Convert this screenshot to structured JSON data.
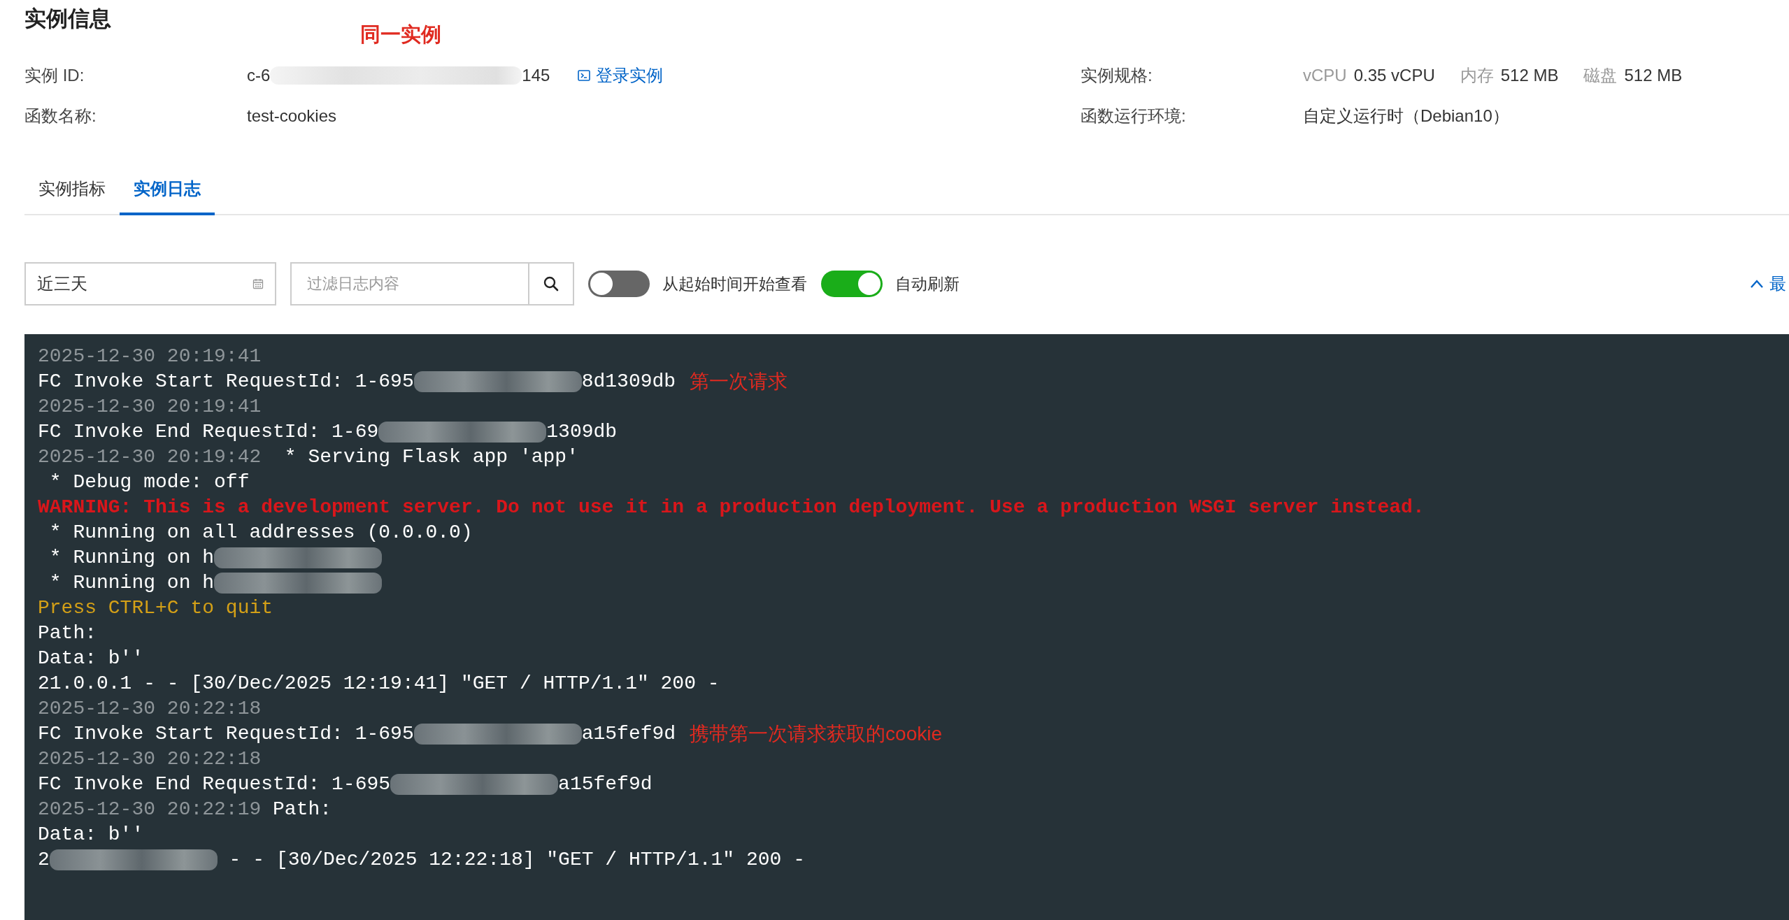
{
  "title": "实例信息",
  "annotation": "同一实例",
  "info_left": [
    {
      "label": "实例 ID:",
      "value": [
        {
          "kind": "text",
          "text": "c-6"
        },
        {
          "kind": "redacted"
        },
        {
          "kind": "text",
          "text": "145"
        }
      ],
      "link": "登录实例"
    },
    {
      "label": "函数名称:",
      "value": [
        {
          "kind": "text",
          "text": "test-cookies"
        }
      ]
    }
  ],
  "info_right": [
    {
      "label": "实例规格:",
      "specs": [
        {
          "name": "vCPU",
          "value": "0.35 vCPU"
        },
        {
          "name": "内存",
          "value": "512 MB"
        },
        {
          "name": "磁盘",
          "value": "512 MB"
        }
      ]
    },
    {
      "label": "函数运行环境:",
      "text": "自定义运行时（Debian10）"
    }
  ],
  "tabs": [
    {
      "label": "实例指标",
      "selected": false
    },
    {
      "label": "实例日志",
      "selected": true
    }
  ],
  "filters": {
    "date_range": "近三天",
    "search": {
      "placeholder": "过滤日志内容"
    },
    "toggles": [
      {
        "label": "从起始时间开始查看",
        "on": false
      },
      {
        "label": "自动刷新",
        "on": true
      }
    ],
    "collapse": "最"
  },
  "log": [
    {
      "parts": [
        {
          "kind": "time",
          "text": "2025-12-30 20:19:41"
        }
      ]
    },
    {
      "parts": [
        {
          "kind": "text",
          "text": "FC Invoke Start RequestId: 1-695"
        },
        {
          "kind": "redacted"
        },
        {
          "kind": "text",
          "text": "8d1309db"
        }
      ],
      "note": "第一次请求"
    },
    {
      "parts": [
        {
          "kind": "time",
          "text": "2025-12-30 20:19:41"
        }
      ]
    },
    {
      "parts": [
        {
          "kind": "text",
          "text": "FC Invoke End RequestId: 1-69"
        },
        {
          "kind": "redacted"
        },
        {
          "kind": "text",
          "text": "1309db"
        }
      ]
    },
    {
      "parts": [
        {
          "kind": "time",
          "text": "2025-12-30 20:19:42"
        },
        {
          "kind": "text",
          "text": "  * Serving Flask app 'app'"
        }
      ]
    },
    {
      "parts": [
        {
          "kind": "text",
          "text": " * Debug mode: off"
        }
      ]
    },
    {
      "parts": [
        {
          "kind": "warn",
          "text": "WARNING: This is a development server. Do not use it in a production deployment. Use a production WSGI server instead."
        }
      ]
    },
    {
      "parts": [
        {
          "kind": "text",
          "text": " * Running on all addresses (0.0.0.0)"
        }
      ]
    },
    {
      "parts": [
        {
          "kind": "text",
          "text": " * Running on h"
        },
        {
          "kind": "redacted"
        }
      ]
    },
    {
      "parts": [
        {
          "kind": "text",
          "text": " * Running on h"
        },
        {
          "kind": "redacted"
        }
      ]
    },
    {
      "parts": [
        {
          "kind": "prompt",
          "text": "Press CTRL+C to quit"
        }
      ]
    },
    {
      "parts": [
        {
          "kind": "text",
          "text": "Path:"
        }
      ]
    },
    {
      "parts": [
        {
          "kind": "text",
          "text": "Data: b''"
        }
      ]
    },
    {
      "parts": [
        {
          "kind": "text",
          "text": "21.0.0.1 - - [30/Dec/2025 12:19:41] \"GET / HTTP/1.1\" 200 -"
        }
      ]
    },
    {
      "parts": [
        {
          "kind": "time",
          "text": "2025-12-30 20:22:18"
        }
      ]
    },
    {
      "parts": [
        {
          "kind": "text",
          "text": "FC Invoke Start RequestId: 1-695"
        },
        {
          "kind": "redacted"
        },
        {
          "kind": "text",
          "text": "a15fef9d"
        }
      ],
      "note": "携带第一次请求获取的cookie"
    },
    {
      "parts": [
        {
          "kind": "time",
          "text": "2025-12-30 20:22:18"
        }
      ]
    },
    {
      "parts": [
        {
          "kind": "text",
          "text": "FC Invoke End RequestId: 1-695"
        },
        {
          "kind": "redacted"
        },
        {
          "kind": "text",
          "text": "a15fef9d"
        }
      ]
    },
    {
      "parts": [
        {
          "kind": "time",
          "text": "2025-12-30 20:22:19"
        },
        {
          "kind": "text",
          "text": " Path:"
        }
      ]
    },
    {
      "parts": [
        {
          "kind": "text",
          "text": "Data: b''"
        }
      ]
    },
    {
      "parts": [
        {
          "kind": "text",
          "text": "2"
        },
        {
          "kind": "redacted"
        },
        {
          "kind": "text",
          "text": " - - [30/Dec/2025 12:22:18] \"GET / HTTP/1.1\" 200 -"
        }
      ]
    }
  ]
}
